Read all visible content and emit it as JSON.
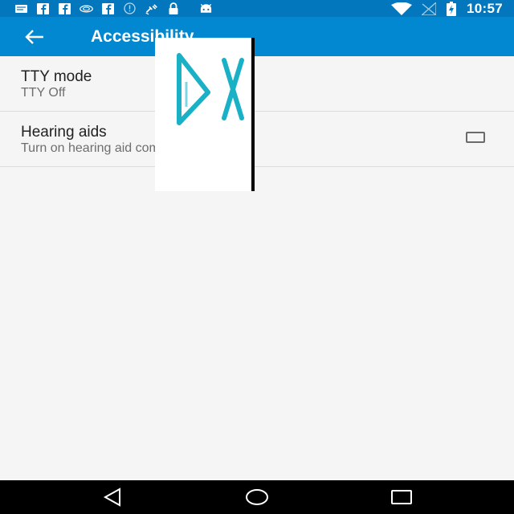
{
  "status_bar": {
    "time": "10:57",
    "left_icons": [
      "message-icon",
      "facebook-icon",
      "facebook-icon",
      "nvidia-icon",
      "facebook-icon",
      "alert-icon",
      "satellite-icon",
      "lock-icon",
      "android-icon"
    ],
    "right_icons": [
      "wifi-icon",
      "no-signal-icon",
      "battery-charging-icon"
    ]
  },
  "app_bar": {
    "title": "Accessibility",
    "back_icon": "arrow-back-icon",
    "color": "#0288d1"
  },
  "settings": [
    {
      "title": "TTY mode",
      "summary": "TTY Off",
      "has_checkbox": false
    },
    {
      "title": "Hearing aids",
      "summary": "Turn on hearing aid compatibility",
      "has_checkbox": true,
      "checked": false
    }
  ],
  "overlay": {
    "logo_text": "DX",
    "color": "#1ab1c6"
  },
  "nav_bar": {
    "buttons": [
      "back-triangle-icon",
      "home-circle-icon",
      "recents-square-icon"
    ]
  }
}
